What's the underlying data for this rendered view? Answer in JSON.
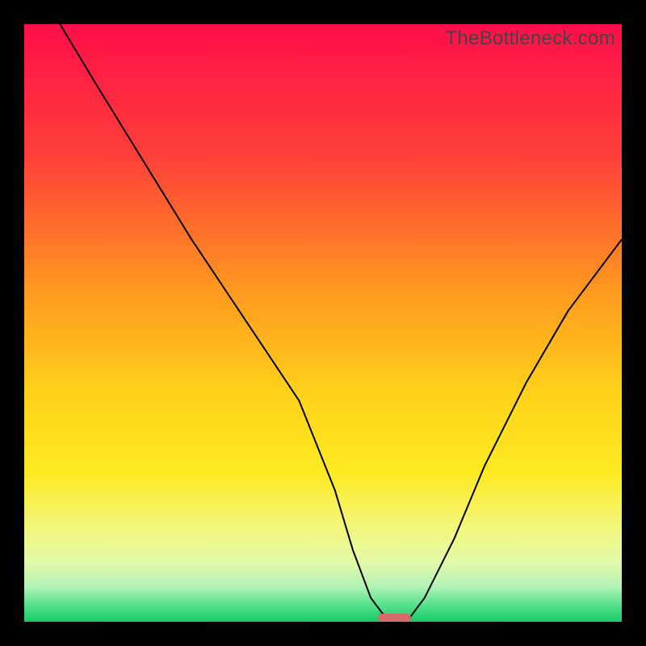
{
  "watermark": "TheBottleneck.com",
  "chart_data": {
    "type": "line",
    "title": "",
    "xlabel": "",
    "ylabel": "",
    "xlim": [
      0,
      100
    ],
    "ylim": [
      0,
      100
    ],
    "series": [
      {
        "name": "bottleneck-curve",
        "x": [
          6,
          12,
          20,
          28,
          34,
          40,
          46,
          52,
          55,
          58,
          61,
          64,
          67,
          72,
          77,
          84,
          91,
          100
        ],
        "values": [
          100,
          90,
          77,
          64,
          55,
          46,
          37,
          22,
          12,
          4,
          0,
          0,
          4,
          14,
          26,
          40,
          52,
          64
        ]
      }
    ],
    "marker": {
      "x": 62,
      "y": 0,
      "width_pct": 5.5,
      "height_pct": 1.4
    },
    "gradient_stops": [
      {
        "offset": 0,
        "color": "#ff0e4a"
      },
      {
        "offset": 22,
        "color": "#ff3f39"
      },
      {
        "offset": 45,
        "color": "#ff9a1f"
      },
      {
        "offset": 62,
        "color": "#ffd21a"
      },
      {
        "offset": 75,
        "color": "#fdea21"
      },
      {
        "offset": 84,
        "color": "#f4f67a"
      },
      {
        "offset": 90,
        "color": "#e3f9a8"
      },
      {
        "offset": 94,
        "color": "#b4f3b6"
      },
      {
        "offset": 97,
        "color": "#5be38e"
      },
      {
        "offset": 100,
        "color": "#17c969"
      }
    ]
  }
}
